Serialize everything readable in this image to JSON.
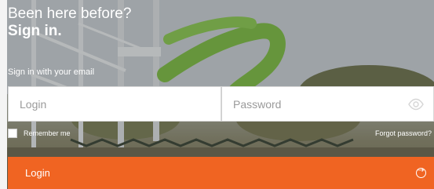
{
  "hero": {
    "question": "Been here before?",
    "title": "Sign in."
  },
  "form": {
    "email_hint": "Sign in with your email",
    "login_placeholder": "Login",
    "password_placeholder": "Password",
    "remember_label": "Remember me",
    "remember_checked": false,
    "forgot_label": "Forgot password?",
    "submit_label": "Login"
  },
  "icons": {
    "password_toggle": "eye-icon",
    "submit": "arrow-right-circle-icon"
  },
  "colors": {
    "accent": "#f06422",
    "text_on_photo": "#ffffff"
  }
}
